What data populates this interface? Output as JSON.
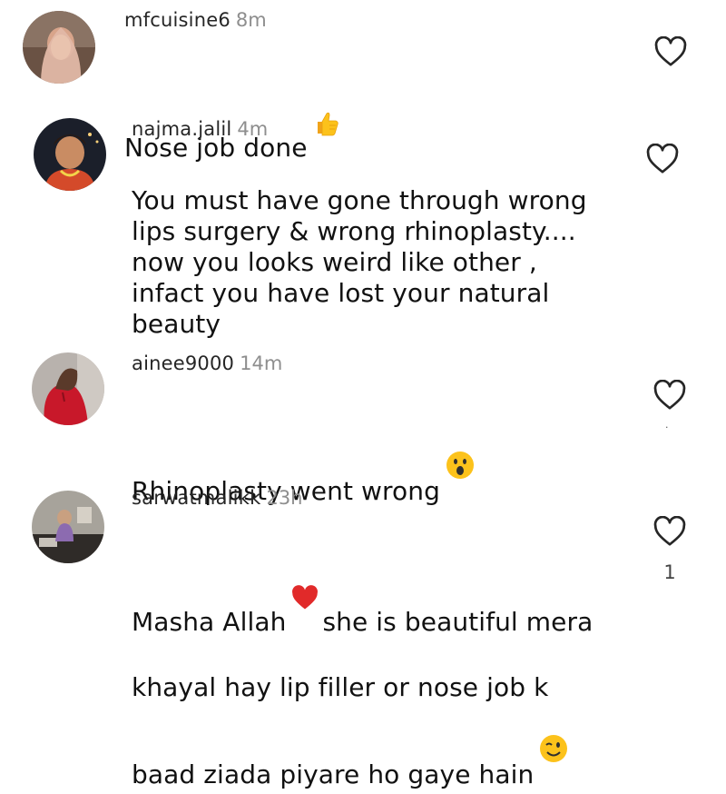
{
  "comments": [
    {
      "username": "mfcuisine6",
      "time": "8m",
      "text": "Nose job done",
      "emoji": "thumbs-up-emoji",
      "like_count": ""
    },
    {
      "username": "najma.jalil",
      "time": "4m",
      "text": "You must have gone through wrong\nlips surgery & wrong rhinoplasty....\nnow you looks weird like other ,\ninfact you have lost your natural\nbeauty",
      "emoji": "",
      "like_count": ""
    },
    {
      "username": "ainee9000",
      "time": "14m",
      "text": "Rhinoplasty went wrong",
      "emoji": "surprised-face-emoji",
      "like_count": ""
    },
    {
      "username": "sarwatmalikk",
      "time": "23h",
      "text_line1_before": "Masha Allah",
      "text_line1_after": "she is beautiful mera",
      "text_rest": "khayal hay lip filler or nose job k\nbaad ziada piyare ho gaye hain",
      "emoji_inline": "red-heart-emoji",
      "emoji": "winking-face-emoji",
      "like_count": "1"
    }
  ],
  "colors": {
    "text": "#111111",
    "username": "#262626",
    "time": "#8e8e8e",
    "heart_outline": "#262626"
  }
}
